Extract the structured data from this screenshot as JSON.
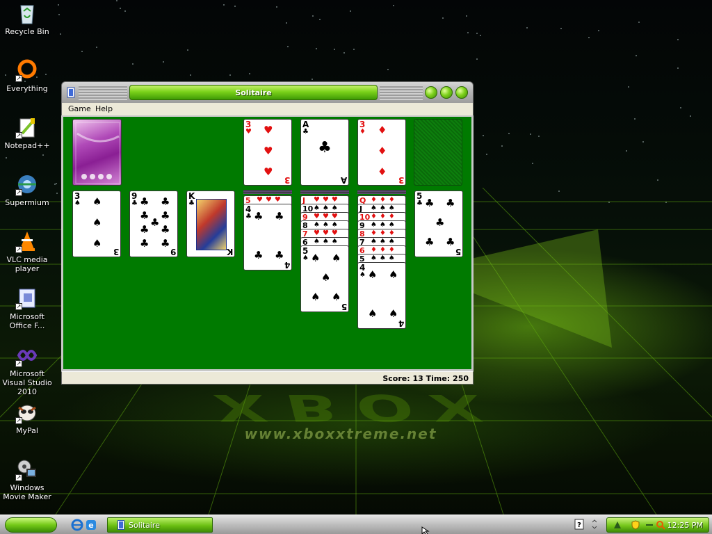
{
  "desktop": {
    "icons": [
      {
        "label": "Recycle Bin",
        "icon": "recycle-bin-icon"
      },
      {
        "label": "Everything",
        "icon": "everything-search-icon"
      },
      {
        "label": "Notepad++",
        "icon": "notepad-plus-plus-icon"
      },
      {
        "label": "Supermium",
        "icon": "supermium-browser-icon"
      },
      {
        "label": "VLC media player",
        "icon": "vlc-cone-icon"
      },
      {
        "label": "Microsoft Office F...",
        "icon": "office-file-icon"
      },
      {
        "label": "Microsoft Visual Studio 2010",
        "icon": "visual-studio-icon"
      },
      {
        "label": "MyPal",
        "icon": "mypal-browser-icon"
      },
      {
        "label": "Windows Movie Maker",
        "icon": "movie-maker-icon"
      }
    ],
    "wallpaper_logo": "XBOX",
    "wallpaper_url": "www.xboxxtreme.net"
  },
  "window": {
    "title": "Solitaire",
    "menu": [
      "Game",
      "Help"
    ],
    "status": "Score: 13 Time: 250"
  },
  "solitaire": {
    "foundations": [
      {
        "rank": "3",
        "suit": "♥",
        "color": "red"
      },
      {
        "rank": "A",
        "suit": "♣",
        "color": "black"
      },
      {
        "rank": "3",
        "suit": "♦",
        "color": "red"
      }
    ],
    "tableau": [
      {
        "top": {
          "rank": "3",
          "suit": "♠",
          "color": "black"
        }
      },
      {
        "top": {
          "rank": "9",
          "suit": "♣",
          "color": "black"
        }
      },
      {
        "top": {
          "rank": "K",
          "suit": "♣",
          "color": "black"
        }
      },
      {
        "peeks": [
          {
            "rank": "5",
            "suit": "♥",
            "color": "red"
          }
        ],
        "top": {
          "rank": "4",
          "suit": "♣",
          "color": "black"
        }
      },
      {
        "peeks": [
          {
            "rank": "J",
            "suit": "♥",
            "color": "red"
          },
          {
            "rank": "10",
            "suit": "♠",
            "color": "black"
          },
          {
            "rank": "9",
            "suit": "♥",
            "color": "red"
          },
          {
            "rank": "8",
            "suit": "♠",
            "color": "black"
          },
          {
            "rank": "7",
            "suit": "♥",
            "color": "red"
          },
          {
            "rank": "6",
            "suit": "♠",
            "color": "black"
          }
        ],
        "top": {
          "rank": "5",
          "suit": "♠",
          "color": "black"
        }
      },
      {
        "peeks": [
          {
            "rank": "Q",
            "suit": "♦",
            "color": "red"
          },
          {
            "rank": "J",
            "suit": "♠",
            "color": "black"
          },
          {
            "rank": "10",
            "suit": "♦",
            "color": "red"
          },
          {
            "rank": "9",
            "suit": "♠",
            "color": "black"
          },
          {
            "rank": "8",
            "suit": "♦",
            "color": "red"
          },
          {
            "rank": "7",
            "suit": "♠",
            "color": "black"
          },
          {
            "rank": "6",
            "suit": "♦",
            "color": "red"
          },
          {
            "rank": "5",
            "suit": "♠",
            "color": "black"
          }
        ],
        "top": {
          "rank": "4",
          "suit": "♠",
          "color": "black"
        }
      },
      {
        "top": {
          "rank": "5",
          "suit": "♣",
          "color": "black"
        }
      }
    ]
  },
  "taskbar": {
    "task_label": "Solitaire",
    "clock": "12:25 PM",
    "quick_launch": [
      "internet-explorer-icon",
      "ie-alt-icon"
    ],
    "tray_icons": [
      "help-icon",
      "network-icon",
      "shield-icon",
      "search-icon"
    ]
  },
  "colors": {
    "felt": "#007a00",
    "accent_green": "#6bbf12",
    "card_red": "#e21010"
  }
}
